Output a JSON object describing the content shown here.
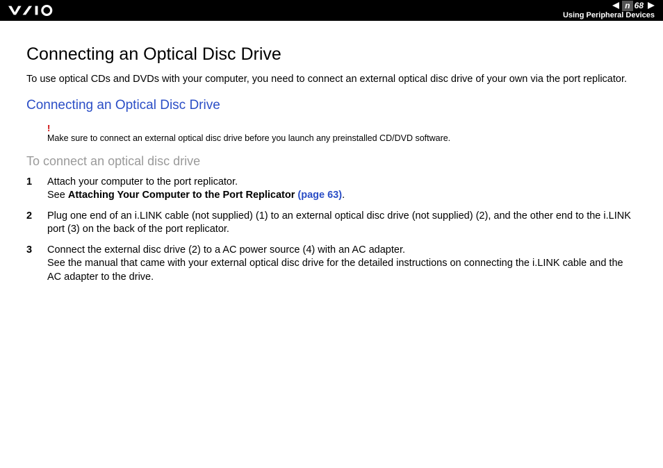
{
  "header": {
    "page_number": "68",
    "n_label": "n",
    "section": "Using Peripheral Devices"
  },
  "title": "Connecting an Optical Disc Drive",
  "intro": "To use optical CDs and DVDs with your computer, you need to connect an external optical disc drive of your own via the port replicator.",
  "subtitle": "Connecting an Optical Disc Drive",
  "warning": {
    "mark": "!",
    "text": "Make sure to connect an external optical disc drive before you launch any preinstalled CD/DVD software."
  },
  "howto_title": "To connect an optical disc drive",
  "steps": [
    {
      "text_a": "Attach your computer to the port replicator.",
      "text_b_prefix": "See ",
      "text_b_bold": "Attaching Your Computer to the Port Replicator ",
      "text_b_link": "(page 63)",
      "text_b_suffix": "."
    },
    {
      "text": "Plug one end of an i.LINK cable (not supplied) (1) to an external optical disc drive (not supplied) (2), and the other end to the i.LINK port (3) on the back of the port replicator."
    },
    {
      "text_a": "Connect the external disc drive (2) to a AC power source (4) with an AC adapter.",
      "text_b": "See the manual that came with your external optical disc drive for the detailed instructions on connecting the i.LINK cable and the AC adapter to the drive."
    }
  ]
}
